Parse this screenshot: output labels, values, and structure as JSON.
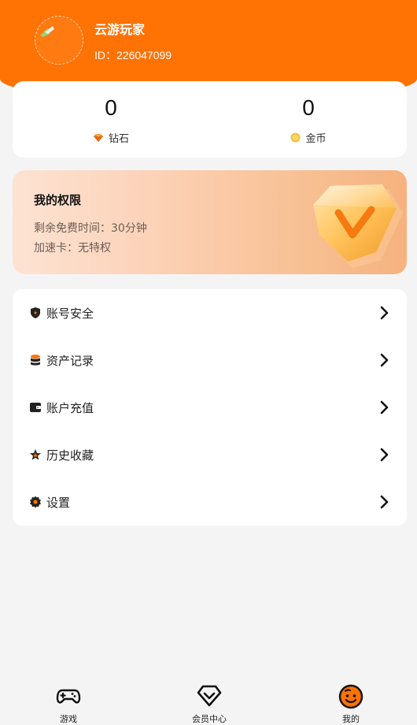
{
  "profile": {
    "username": "云游玩家",
    "user_id": "ID：226047099"
  },
  "stats": {
    "diamonds": {
      "value": "0",
      "label": "钻石",
      "icon": "diamond-icon"
    },
    "coins": {
      "value": "0",
      "label": "金币",
      "icon": "coin-icon"
    }
  },
  "privileges": {
    "title": "我的权限",
    "free_time": "剩余免费时间：30分钟",
    "speed_card": "加速卡：无特权"
  },
  "menu": [
    {
      "label": "账号安全",
      "icon": "shield-icon"
    },
    {
      "label": "资产记录",
      "icon": "database-icon"
    },
    {
      "label": "账户充值",
      "icon": "wallet-icon"
    },
    {
      "label": "历史收藏",
      "icon": "star-icon"
    },
    {
      "label": "设置",
      "icon": "gear-icon"
    }
  ],
  "tabs": [
    {
      "label": "游戏",
      "icon": "gamepad-icon"
    },
    {
      "label": "会员中心",
      "icon": "vip-diamond-icon"
    },
    {
      "label": "我的",
      "icon": "smiley-icon",
      "active": true
    }
  ],
  "colors": {
    "brand": "#ff7204",
    "background": "#f4f4f4"
  }
}
